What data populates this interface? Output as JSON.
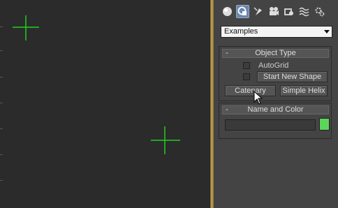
{
  "panel": {
    "tabs": [
      {
        "name": "geometry-icon"
      },
      {
        "name": "shapes-icon",
        "active": true
      },
      {
        "name": "lights-icon"
      },
      {
        "name": "cameras-icon"
      },
      {
        "name": "helpers-icon"
      },
      {
        "name": "spacewarps-icon"
      },
      {
        "name": "systems-icon"
      }
    ],
    "dropdown_value": "Examples",
    "object_type": {
      "title": "Object Type",
      "collapse": "-",
      "autogrid_label": "AutoGrid",
      "start_new_shape_label": "Start New Shape",
      "buttons": [
        "Catenary",
        "Simple Helix"
      ]
    },
    "name_and_color": {
      "title": "Name and Color",
      "collapse": "-",
      "name_value": "",
      "color": "#5bd55b"
    }
  },
  "viewport": {
    "background": "#2b2b2b",
    "crosshair_color": "#1fd01f"
  }
}
